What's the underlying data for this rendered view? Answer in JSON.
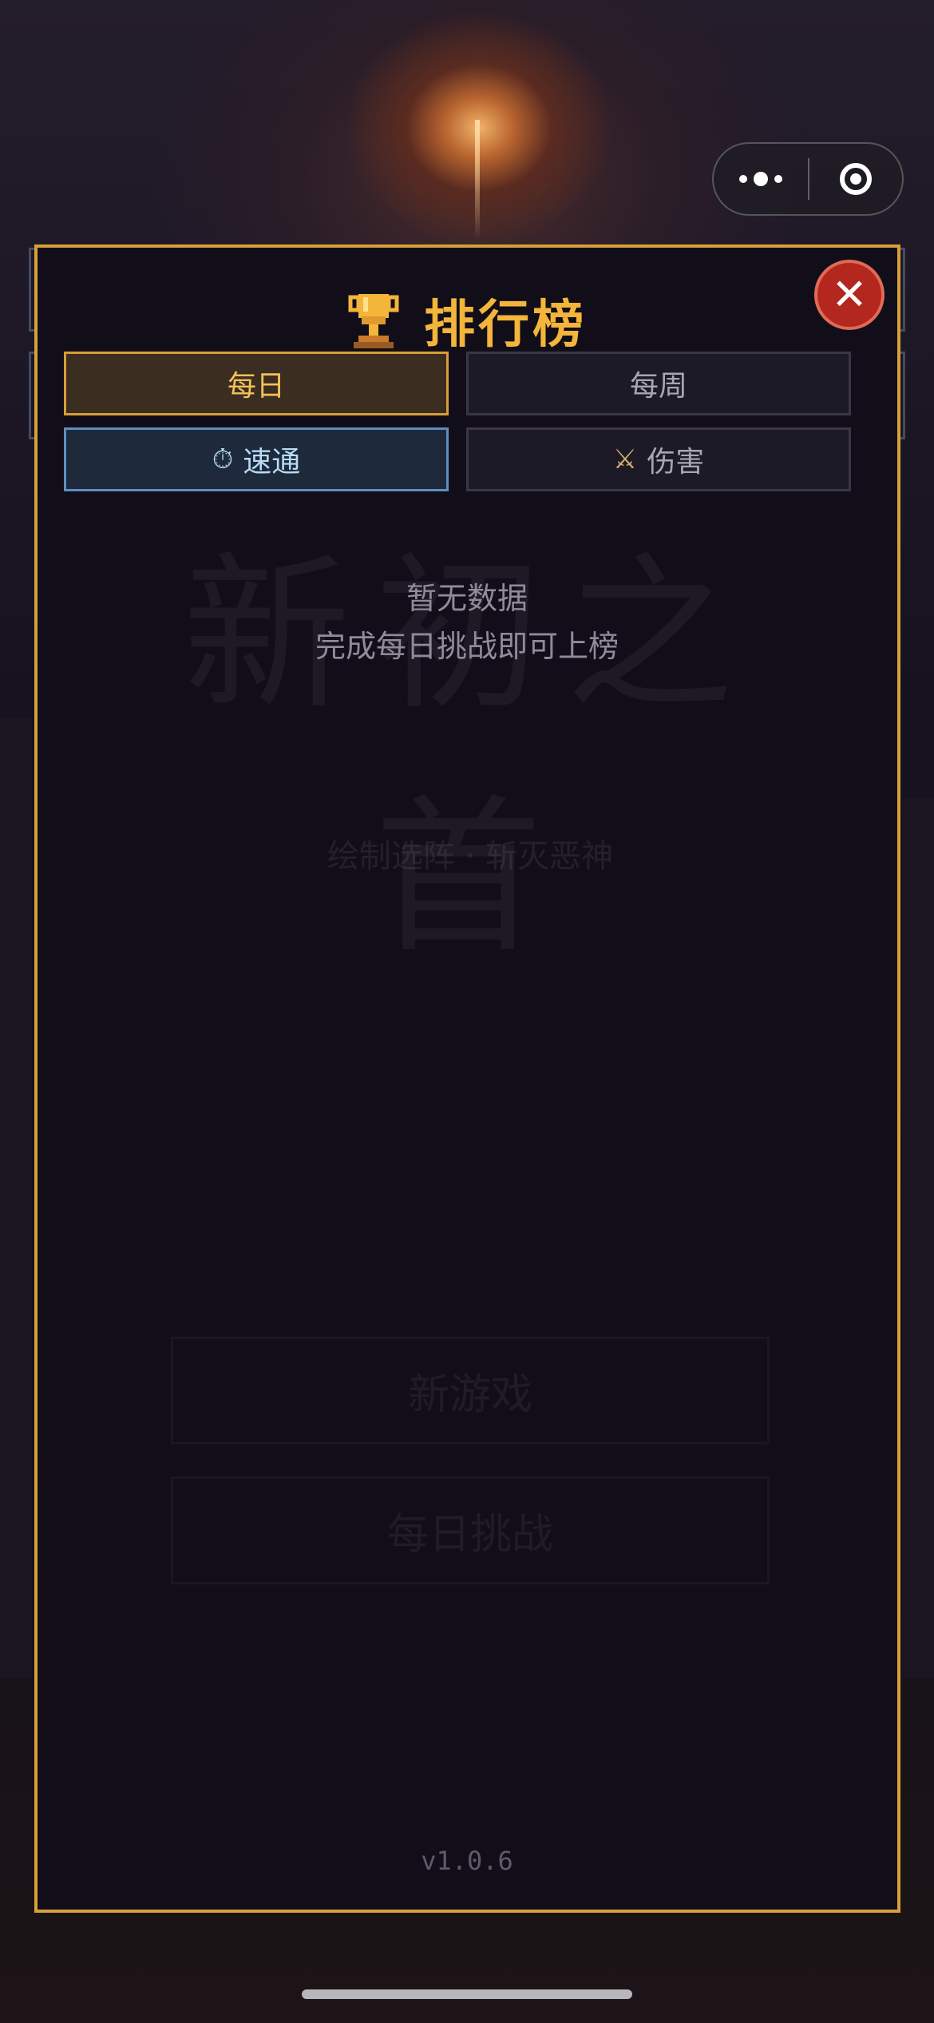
{
  "capsule": {
    "more_icon": "more-dots-icon",
    "close_icon": "target-close-icon"
  },
  "background": {
    "ghost_title": "新初之首",
    "ghost_subtitle": "绘制选阵 · 斩灭恶神",
    "ghost_buttons": [
      "新游戏",
      "每日挑战"
    ]
  },
  "leaderboard": {
    "title": "排行榜",
    "title_icon": "trophy-icon",
    "close_icon": "close-icon",
    "close_symbol": "✕",
    "period_tabs": [
      {
        "label": "每日",
        "selected": true
      },
      {
        "label": "每周",
        "selected": false
      }
    ],
    "mode_tabs": [
      {
        "label": "速通",
        "icon": "stopwatch-icon",
        "glyph": "⏱",
        "selected": true
      },
      {
        "label": "伤害",
        "icon": "crossed-swords-icon",
        "glyph": "⚔",
        "selected": false
      }
    ],
    "empty_state": {
      "line1": "暂无数据",
      "line2": "完成每日挑战即可上榜"
    },
    "version": "v1.0.6"
  },
  "colors": {
    "accent_gold": "#d7a038",
    "close_red": "#b3271f",
    "selected_blue": "#5d8fc0"
  }
}
